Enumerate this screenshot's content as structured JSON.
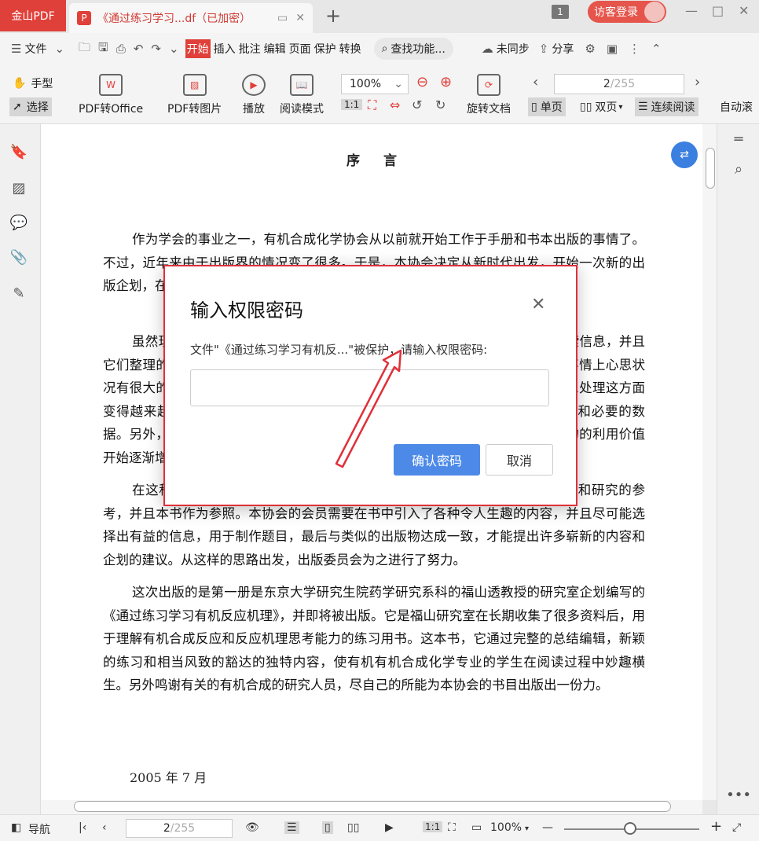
{
  "titlebar": {
    "app_name": "金山PDF",
    "doc_tab_badge": "P",
    "doc_tab_title": "《通过练习学习...df（已加密）",
    "tab_count": "1",
    "guest_login": "访客登录"
  },
  "menu": {
    "file": "文件",
    "tabs": [
      "开始",
      "插入",
      "批注",
      "编辑",
      "页面",
      "保护",
      "转换"
    ],
    "search": "查找功能...",
    "sync": "未同步",
    "share": "分享"
  },
  "toolbar": {
    "hand": "手型",
    "select": "选择",
    "pdf_to_office": "PDF转Office",
    "pdf_to_image": "PDF转图片",
    "play": "播放",
    "reading_mode": "阅读模式",
    "zoom": "100%",
    "rotate_doc": "旋转文档",
    "page_current": "2",
    "page_total": "/255",
    "single_page": "单页",
    "double_page": "双页",
    "continuous": "连续阅读",
    "auto_scroll": "自动滚"
  },
  "document": {
    "heading": "序言",
    "paragraphs": [
      "作为学会的事业之一，有机合成化学协会从以前就开始工作于手册和书本出版的事情了。不过，近年来由于出版界的情况变了很多。于是，本协会决定从新时代出发，开始一次新的出版企划，在出版委员会中进行了深入的研究，确定了今后的出版企划。",
      "虽然现在有机合成化学领域中的信息量很大，而且通过计算机能够迅速地检索信息，并且它们整理的各种数据库也可以得到，但是，为了使学习者掌握有机合成化学，在事情上心思状况有很大的变化。因此，在这种信息化的时代，随着计算机技术的迅速发展，信息处理这方面变得越来越容易了。但是，人们需要的不仅仅是信息，需要的是经过精选的信息和必要的数据。另外，学习和理解有机合成化学的基本概念，对于学生和研究者，书籍和刊物的利用价值开始逐渐增加。",
      "在这种背景下，出版委员会决定出版一系列的书籍，希望它们能够成为学习和研究的参考，并且本书作为参照。本协会的会员需要在书中引入了各种令人生趣的内容，并且尽可能选择出有益的信息，用于制作题目，最后与类似的出版物达成一致，才能提出许多崭新的内容和企划的建议。从这样的思路出发，出版委员会为之进行了努力。",
      "这次出版的是第一册是东京大学研究生院药学研究系科的福山透教授的研究室企划编写的《通过练习学习有机反应机理》，并即将被出版。它是福山研究室在长期收集了很多资料后，用于理解有机合成反应和反应机理思考能力的练习用书。这本书，它通过完整的总结编辑，新颖的练习和相当风致的豁达的独特内容，使有机有机合成化学专业的学生在阅读过程中妙趣横生。另外鸣谢有关的有机合成的研究人员，尽自己的所能为本协会的书目出版出一份力。"
    ],
    "date": "2005 年 7 月"
  },
  "dialog": {
    "title": "输入权限密码",
    "message": "文件\"《通过练习学习有机反...\"被保护，请输入权限密码:",
    "password_value": "",
    "confirm": "确认密码",
    "cancel": "取消"
  },
  "statusbar": {
    "nav": "导航",
    "page_current": "2",
    "page_total": "/255",
    "zoom": "100%"
  },
  "colors": {
    "brand_red": "#e0403a",
    "primary_blue": "#4d8ae8",
    "annotation_red": "#e0303a"
  }
}
